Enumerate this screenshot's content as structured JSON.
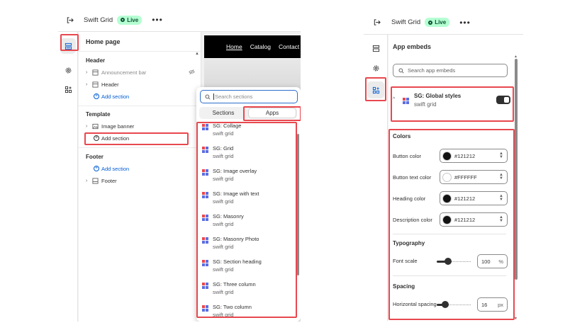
{
  "left": {
    "topbar": {
      "title": "Swift Grid",
      "status": "Live"
    },
    "sidebar": {
      "title": "Home page",
      "header_group": "Header",
      "header_items": [
        "Announcement bar",
        "Header"
      ],
      "header_add": "Add section",
      "template_group": "Template",
      "template_items": [
        "Image banner"
      ],
      "template_add": "Add section",
      "footer_group": "Footer",
      "footer_add": "Add section",
      "footer_items": [
        "Footer"
      ]
    },
    "preview_nav": [
      "Home",
      "Catalog",
      "Contact"
    ],
    "popover": {
      "search_placeholder": "Search sections",
      "tabs": [
        "Sections",
        "Apps"
      ],
      "active_tab": "Apps",
      "items": [
        {
          "name": "SG: Collage",
          "app": "swift grid"
        },
        {
          "name": "SG: Grid",
          "app": "swift grid"
        },
        {
          "name": "SG: Image overlay",
          "app": "swift grid"
        },
        {
          "name": "SG: Image with text",
          "app": "swift grid"
        },
        {
          "name": "SG: Masonry",
          "app": "swift grid"
        },
        {
          "name": "SG: Masonry Photo",
          "app": "swift grid"
        },
        {
          "name": "SG: Section heading",
          "app": "swift grid"
        },
        {
          "name": "SG: Three column",
          "app": "swift grid"
        },
        {
          "name": "SG: Two column",
          "app": "swift grid"
        }
      ]
    }
  },
  "right": {
    "topbar": {
      "title": "Swift Grid",
      "status": "Live"
    },
    "title": "App embeds",
    "search_placeholder": "Search app embeds",
    "embed": {
      "name": "SG: Global styles",
      "app": "swift grid",
      "enabled": true
    },
    "colors": {
      "title": "Colors",
      "rows": [
        {
          "label": "Button color",
          "value": "#121212"
        },
        {
          "label": "Button text color",
          "value": "#FFFFFF"
        },
        {
          "label": "Heading color",
          "value": "#121212"
        },
        {
          "label": "Description color",
          "value": "#121212"
        }
      ]
    },
    "typography": {
      "title": "Typography",
      "font_scale": {
        "label": "Font scale",
        "value": "100",
        "unit": "%",
        "level": 0.3
      }
    },
    "spacing": {
      "title": "Spacing",
      "horizontal": {
        "label": "Horizontal spacing",
        "value": "16",
        "unit": "px",
        "level": 0.2
      }
    }
  },
  "colors": {
    "accent_blue": "#005bd3",
    "highlight_red": "#e8484f",
    "live_bg": "#b4fed2"
  }
}
